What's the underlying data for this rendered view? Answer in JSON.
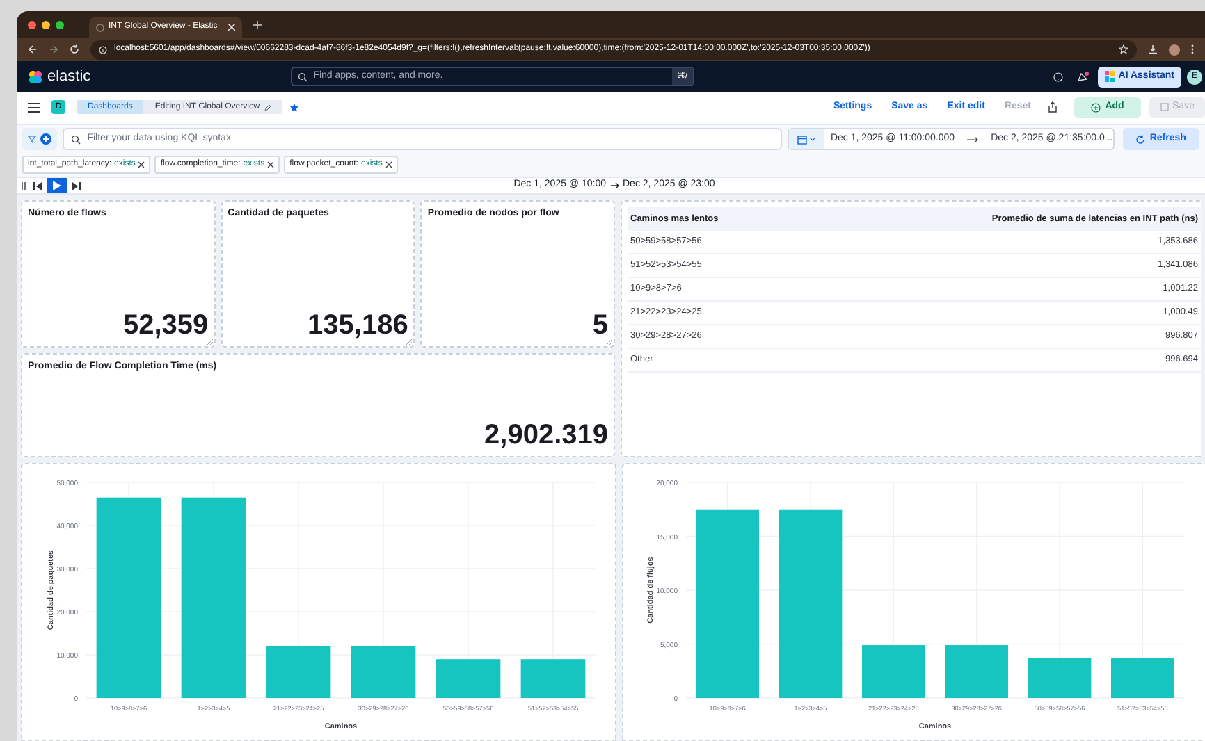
{
  "browser": {
    "tab_title": "INT Global Overview - Elastic",
    "url": "localhost:5601/app/dashboards#/view/00662283-dcad-4af7-86f3-1e82e4054d9f?_g=(filters:!(),refreshInterval:(pause:!t,value:60000),time:(from:'2025-12-01T14:00:00.000Z',to:'2025-12-03T00:35:00.000Z'))"
  },
  "header": {
    "logo_text": "elastic",
    "search_placeholder": "Find apps, content, and more.",
    "shortcut": "⌘/",
    "ai_button": "AI Assistant",
    "avatar": "E"
  },
  "toolbar": {
    "space_badge": "D",
    "breadcrumbs": [
      {
        "label": "Dashboards"
      },
      {
        "label": "Editing INT Global Overview"
      }
    ],
    "actions": [
      {
        "label": "Settings",
        "disabled": false
      },
      {
        "label": "Save as",
        "disabled": false
      },
      {
        "label": "Exit edit",
        "disabled": false
      },
      {
        "label": "Reset",
        "disabled": true
      }
    ],
    "add_button": "Add",
    "save_button": {
      "label": "Save",
      "disabled": true
    }
  },
  "query": {
    "placeholder": "Filter your data using KQL syntax",
    "start": "Dec 1, 2025 @ 11:00:00.000",
    "end": "Dec 2, 2025 @ 21:35:00.0...",
    "refresh": "Refresh"
  },
  "filters": [
    {
      "field": "int_total_path_latency:",
      "value": "exists"
    },
    {
      "field": "flow.completion_time:",
      "value": "exists"
    },
    {
      "field": "flow.packet_count:",
      "value": "exists"
    }
  ],
  "timeline": {
    "start": "Dec 1, 2025 @ 10:00",
    "end": "Dec 2, 2025 @ 23:00"
  },
  "metrics": [
    {
      "title": "Número de flows",
      "value": "52,359"
    },
    {
      "title": "Cantidad de paquetes",
      "value": "135,186"
    },
    {
      "title": "Promedio de nodos por flow",
      "value": "5"
    }
  ],
  "fct": {
    "title": "Promedio de Flow Completion Time (ms)",
    "value": "2,902.319"
  },
  "table": {
    "columns": [
      "Caminos mas lentos",
      "Promedio de suma de latencias en INT path (ns)"
    ],
    "rows": [
      [
        "50>59>58>57>56",
        "1,353.686"
      ],
      [
        "51>52>53>54>55",
        "1,341.086"
      ],
      [
        "10>9>8>7>6",
        "1,001.22"
      ],
      [
        "21>22>23>24>25",
        "1,000.49"
      ],
      [
        "30>29>28>27>26",
        "996.807"
      ],
      [
        "Other",
        "996.694"
      ]
    ]
  },
  "charts": [
    {
      "chart_data": {
        "type": "bar",
        "xlabel": "Caminos",
        "ylabel": "Cantidad de paquetes",
        "categories": [
          "10>9>8>7>6",
          "1>2>3>4>5",
          "21>22>23>24>25",
          "30>29>28>27>26",
          "50>59>58>57>56",
          "51>52>53>54>55"
        ],
        "grid": true,
        "series": [
          {
            "color": "#16c5c0",
            "values": [
              46500,
              46500,
              12000,
              12000,
              9000,
              9000
            ]
          }
        ],
        "ylim": [
          0,
          50000
        ],
        "yticks": [
          {
            "value": 0,
            "label": "0"
          },
          {
            "value": 10000,
            "label": "10,000"
          },
          {
            "value": 20000,
            "label": "20,000"
          },
          {
            "value": 30000,
            "label": "30,000"
          },
          {
            "value": 40000,
            "label": "40,000"
          },
          {
            "value": 50000,
            "label": "50,000"
          }
        ]
      }
    },
    {
      "chart_data": {
        "type": "bar",
        "xlabel": "Caminos",
        "ylabel": "Cantidad de flujos",
        "categories": [
          "10>9>8>7>6",
          "1>2>3>4>5",
          "21>22>23>24>25",
          "30>29>28>27>26",
          "50>59>58>57>56",
          "51>52>53>54>55"
        ],
        "grid": true,
        "series": [
          {
            "color": "#16c5c0",
            "values": [
              17500,
              17500,
              4900,
              4900,
              3700,
              3700
            ]
          }
        ],
        "ylim": [
          0,
          20000
        ],
        "yticks": [
          {
            "value": 0,
            "label": "0"
          },
          {
            "value": 5000,
            "label": "5,000"
          },
          {
            "value": 10000,
            "label": "10,000"
          },
          {
            "value": 15000,
            "label": "15,000"
          },
          {
            "value": 20000,
            "label": "20,000"
          }
        ]
      }
    }
  ]
}
